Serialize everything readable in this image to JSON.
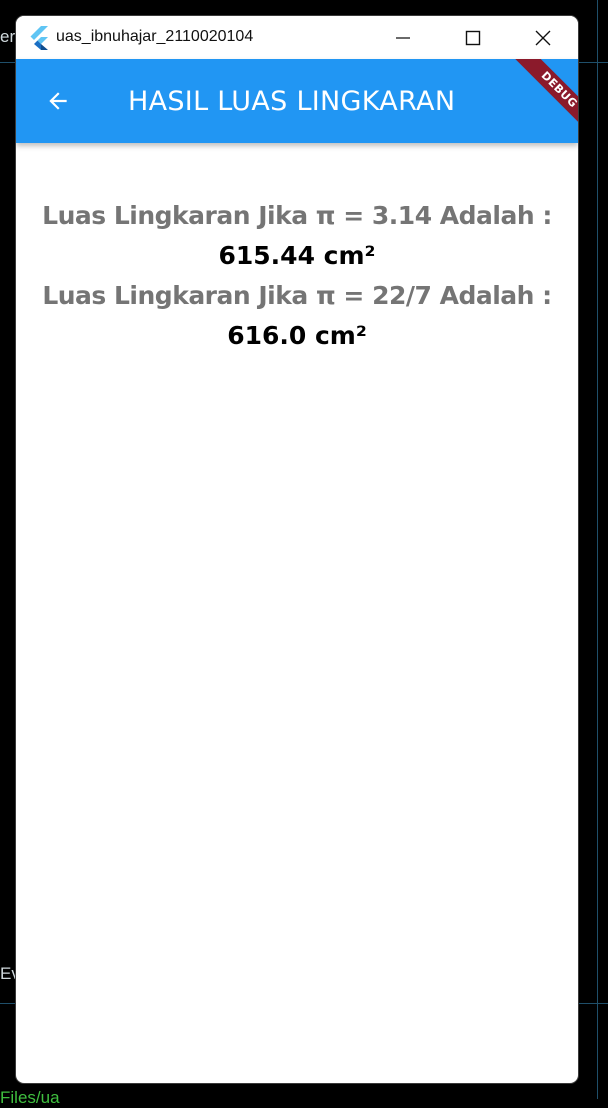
{
  "window": {
    "title": "uas_ibnuhajar_2110020104"
  },
  "appbar": {
    "title": "HASIL LUAS LINGKARAN",
    "debug_label": "DEBUG"
  },
  "results": [
    {
      "label": "Luas Lingkaran Jika π = 3.14 Adalah :",
      "value": "615.44 cm²"
    },
    {
      "label": "Luas Lingkaran Jika π = 22/7 Adalah :",
      "value": "616.0 cm²"
    }
  ],
  "background": {
    "text_top": "er.",
    "text_mid": "Ev",
    "text_bottom": "Files/ua"
  },
  "colors": {
    "appbar": "#2196f3",
    "label": "#757575",
    "value": "#000000",
    "debug": "#8b1a2b"
  }
}
